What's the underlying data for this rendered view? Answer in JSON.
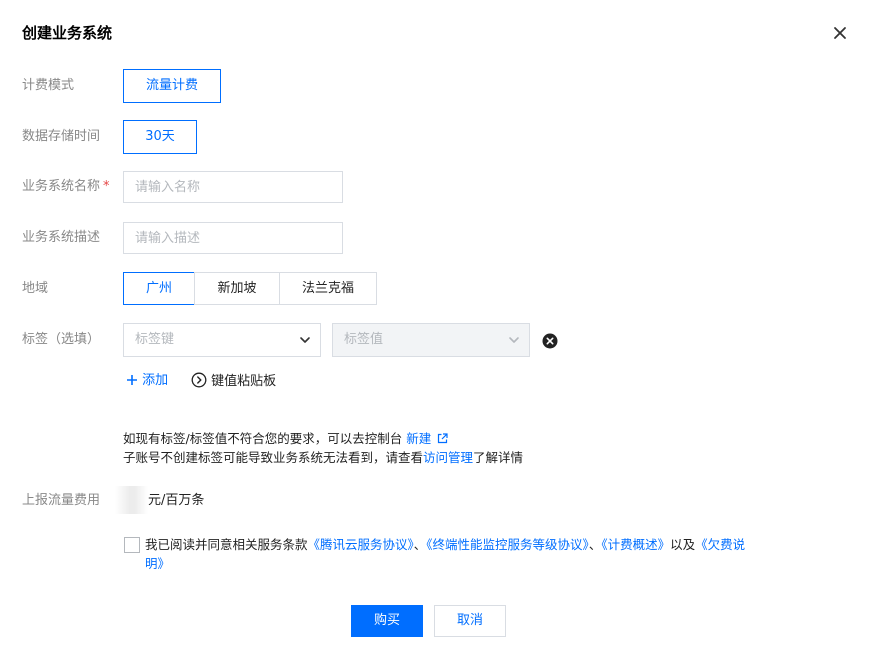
{
  "dialog": {
    "title": "创建业务系统"
  },
  "form": {
    "billing_mode": {
      "label": "计费模式",
      "value": "流量计费"
    },
    "retention": {
      "label": "数据存储时间",
      "value": "30天"
    },
    "system_name": {
      "label": "业务系统名称",
      "required_mark": "*",
      "placeholder": "请输入名称"
    },
    "system_desc": {
      "label": "业务系统描述",
      "placeholder": "请输入描述"
    },
    "region": {
      "label": "地域",
      "options": [
        "广州",
        "新加坡",
        "法兰克福"
      ],
      "selected": "广州"
    },
    "tags": {
      "label": "标签（选填）",
      "key_placeholder": "标签键",
      "value_placeholder": "标签值",
      "add_label": "添加",
      "clipboard_label": "键值粘贴板"
    },
    "tag_notice": {
      "line1_prefix": "如现有标签/标签值不符合您的要求，可以去控制台",
      "line1_link": "新建",
      "line2_prefix": "子账号不创建标签可能导致业务系统无法看到，请查看",
      "line2_link": "访问管理",
      "line2_suffix": "了解详情"
    },
    "fee": {
      "label": "上报流量费用",
      "unit": "元/百万条"
    },
    "agreement": {
      "prefix": "我已阅读并同意相关服务条款",
      "link1": "《腾讯云服务协议》",
      "sep1": "、",
      "link2": "《终端性能监控服务等级协议》",
      "sep2": "、",
      "link3": "《计费概述》",
      "conj": "以及",
      "link4a": "《欠费说",
      "link4b": "明》"
    }
  },
  "footer": {
    "buy_label": "购买",
    "cancel_label": "取消"
  },
  "colors": {
    "accent": "#006eff",
    "border": "#d9dde3",
    "label": "#888888",
    "required": "#e54545"
  }
}
